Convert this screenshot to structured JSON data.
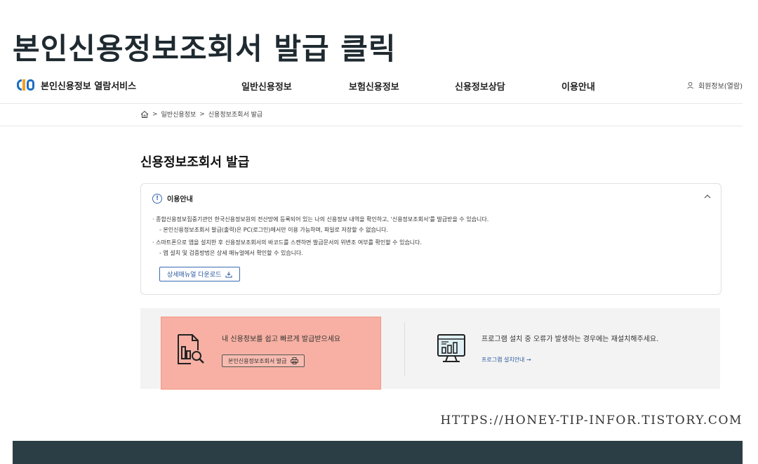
{
  "overlay": {
    "title": "본인신용정보조회서 발급 클릭"
  },
  "header": {
    "logo_text": "본인신용정보 열람서비스",
    "nav": [
      "일반신용정보",
      "보험신용정보",
      "신용정보상담",
      "이용안내"
    ],
    "member_label": "회원정보(열람)"
  },
  "breadcrumb": {
    "sep": ">",
    "items": [
      "일반신용정보",
      "신용정보조회서 발급"
    ]
  },
  "page": {
    "title": "신용정보조회서 발급"
  },
  "info": {
    "heading": "이용안내",
    "lines": [
      "· 종합신용정보집중기관인 한국신용정보원의 전산망에 등록되어 있는 나의 신용정보 내역을 확인하고, '신용정보조회서'를 발급받을 수 있습니다.",
      "- 본인신용정보조회서 발급(출력)은 PC(로그인)에서만 이용 가능하며, 파일로 저장할 수 없습니다.",
      "· 스마트폰으로 앱을 설치한 후 신용정보조회서의 바코드를 스캔하면 발급문서의 위변조 여부를 확인할 수 있습니다.",
      "- 앱 설치 및 검증방법은 상세 매뉴얼에서 확인할 수 있습니다."
    ],
    "download_label": "상세매뉴얼 다운로드"
  },
  "cards": {
    "issue": {
      "text": "내 신용정보를 쉽고 빠르게 발급받으세요",
      "button": "본인신용정보조회서 발급"
    },
    "install": {
      "text": "프로그램 설치 중 오류가 발생하는 경우에는 재설치해주세요.",
      "link": "프로그램 설치안내 →"
    }
  },
  "watermark": {
    "url": "HTTPS://HONEY-TIP-INFOR.TISTORY.COM"
  },
  "colors": {
    "accent": "#3b6ab0",
    "highlight": "#f7b0a3",
    "footer": "#2c3e45"
  }
}
